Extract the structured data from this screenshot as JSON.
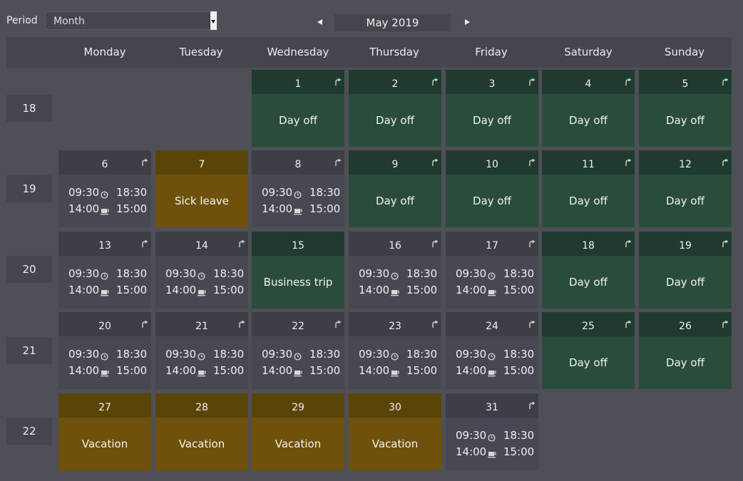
{
  "toolbar": {
    "period_label": "Period",
    "period_value": "Month",
    "current_month": "May 2019"
  },
  "weekdays": [
    "Monday",
    "Tuesday",
    "Wednesday",
    "Thursday",
    "Friday",
    "Saturday",
    "Sunday"
  ],
  "weeks": [
    "18",
    "19",
    "20",
    "21",
    "22"
  ],
  "colors": {
    "background": "#4f4f57",
    "work_head": "#3e3e47",
    "work_body": "#484852",
    "dayoff_head": "#1f3a2e",
    "dayoff_body": "#2a4d3b",
    "leave_head": "#5a4509",
    "leave_body": "#6e520b"
  },
  "icons": {
    "clock": "clock-icon",
    "break": "coffee-cup-icon",
    "corner": "export-arrow-icon"
  },
  "days": [
    {
      "day": "1",
      "week": 0,
      "col": 2,
      "kind": "dayoff",
      "label": "Day off",
      "icon": true
    },
    {
      "day": "2",
      "week": 0,
      "col": 3,
      "kind": "dayoff",
      "label": "Day off",
      "icon": true
    },
    {
      "day": "3",
      "week": 0,
      "col": 4,
      "kind": "dayoff",
      "label": "Day off",
      "icon": true
    },
    {
      "day": "4",
      "week": 0,
      "col": 5,
      "kind": "dayoff",
      "label": "Day off",
      "icon": true
    },
    {
      "day": "5",
      "week": 0,
      "col": 6,
      "kind": "dayoff",
      "label": "Day off",
      "icon": true
    },
    {
      "day": "6",
      "week": 1,
      "col": 0,
      "kind": "work",
      "start": "09:30",
      "end": "18:30",
      "break_start": "14:00",
      "break_end": "15:00",
      "icon": true
    },
    {
      "day": "7",
      "week": 1,
      "col": 1,
      "kind": "leave",
      "label": "Sick leave",
      "icon": false
    },
    {
      "day": "8",
      "week": 1,
      "col": 2,
      "kind": "work",
      "start": "09:30",
      "end": "18:30",
      "break_start": "14:00",
      "break_end": "15:00",
      "icon": true
    },
    {
      "day": "9",
      "week": 1,
      "col": 3,
      "kind": "dayoff",
      "label": "Day off",
      "icon": true
    },
    {
      "day": "10",
      "week": 1,
      "col": 4,
      "kind": "dayoff",
      "label": "Day off",
      "icon": true
    },
    {
      "day": "11",
      "week": 1,
      "col": 5,
      "kind": "dayoff",
      "label": "Day off",
      "icon": true
    },
    {
      "day": "12",
      "week": 1,
      "col": 6,
      "kind": "dayoff",
      "label": "Day off",
      "icon": true
    },
    {
      "day": "13",
      "week": 2,
      "col": 0,
      "kind": "work",
      "start": "09:30",
      "end": "18:30",
      "break_start": "14:00",
      "break_end": "15:00",
      "icon": true
    },
    {
      "day": "14",
      "week": 2,
      "col": 1,
      "kind": "work",
      "start": "09:30",
      "end": "18:30",
      "break_start": "14:00",
      "break_end": "15:00",
      "icon": true
    },
    {
      "day": "15",
      "week": 2,
      "col": 2,
      "kind": "dayoff",
      "label": "Business trip",
      "icon": false
    },
    {
      "day": "16",
      "week": 2,
      "col": 3,
      "kind": "work",
      "start": "09:30",
      "end": "18:30",
      "break_start": "14:00",
      "break_end": "15:00",
      "icon": true
    },
    {
      "day": "17",
      "week": 2,
      "col": 4,
      "kind": "work",
      "start": "09:30",
      "end": "18:30",
      "break_start": "14:00",
      "break_end": "15:00",
      "icon": true
    },
    {
      "day": "18",
      "week": 2,
      "col": 5,
      "kind": "dayoff",
      "label": "Day off",
      "icon": true
    },
    {
      "day": "19",
      "week": 2,
      "col": 6,
      "kind": "dayoff",
      "label": "Day off",
      "icon": true
    },
    {
      "day": "20",
      "week": 3,
      "col": 0,
      "kind": "work",
      "start": "09:30",
      "end": "18:30",
      "break_start": "14:00",
      "break_end": "15:00",
      "icon": true
    },
    {
      "day": "21",
      "week": 3,
      "col": 1,
      "kind": "work",
      "start": "09:30",
      "end": "18:30",
      "break_start": "14:00",
      "break_end": "15:00",
      "icon": true
    },
    {
      "day": "22",
      "week": 3,
      "col": 2,
      "kind": "work",
      "start": "09:30",
      "end": "18:30",
      "break_start": "14:00",
      "break_end": "15:00",
      "icon": true
    },
    {
      "day": "23",
      "week": 3,
      "col": 3,
      "kind": "work",
      "start": "09:30",
      "end": "18:30",
      "break_start": "14:00",
      "break_end": "15:00",
      "icon": true
    },
    {
      "day": "24",
      "week": 3,
      "col": 4,
      "kind": "work",
      "start": "09:30",
      "end": "18:30",
      "break_start": "14:00",
      "break_end": "15:00",
      "icon": true
    },
    {
      "day": "25",
      "week": 3,
      "col": 5,
      "kind": "dayoff",
      "label": "Day off",
      "icon": true
    },
    {
      "day": "26",
      "week": 3,
      "col": 6,
      "kind": "dayoff",
      "label": "Day off",
      "icon": true
    },
    {
      "day": "27",
      "week": 4,
      "col": 0,
      "kind": "leave",
      "label": "Vacation",
      "icon": false
    },
    {
      "day": "28",
      "week": 4,
      "col": 1,
      "kind": "leave",
      "label": "Vacation",
      "icon": false
    },
    {
      "day": "29",
      "week": 4,
      "col": 2,
      "kind": "leave",
      "label": "Vacation",
      "icon": false
    },
    {
      "day": "30",
      "week": 4,
      "col": 3,
      "kind": "leave",
      "label": "Vacation",
      "icon": false
    },
    {
      "day": "31",
      "week": 4,
      "col": 4,
      "kind": "work",
      "start": "09:30",
      "end": "18:30",
      "break_start": "14:00",
      "break_end": "15:00",
      "icon": true
    }
  ]
}
